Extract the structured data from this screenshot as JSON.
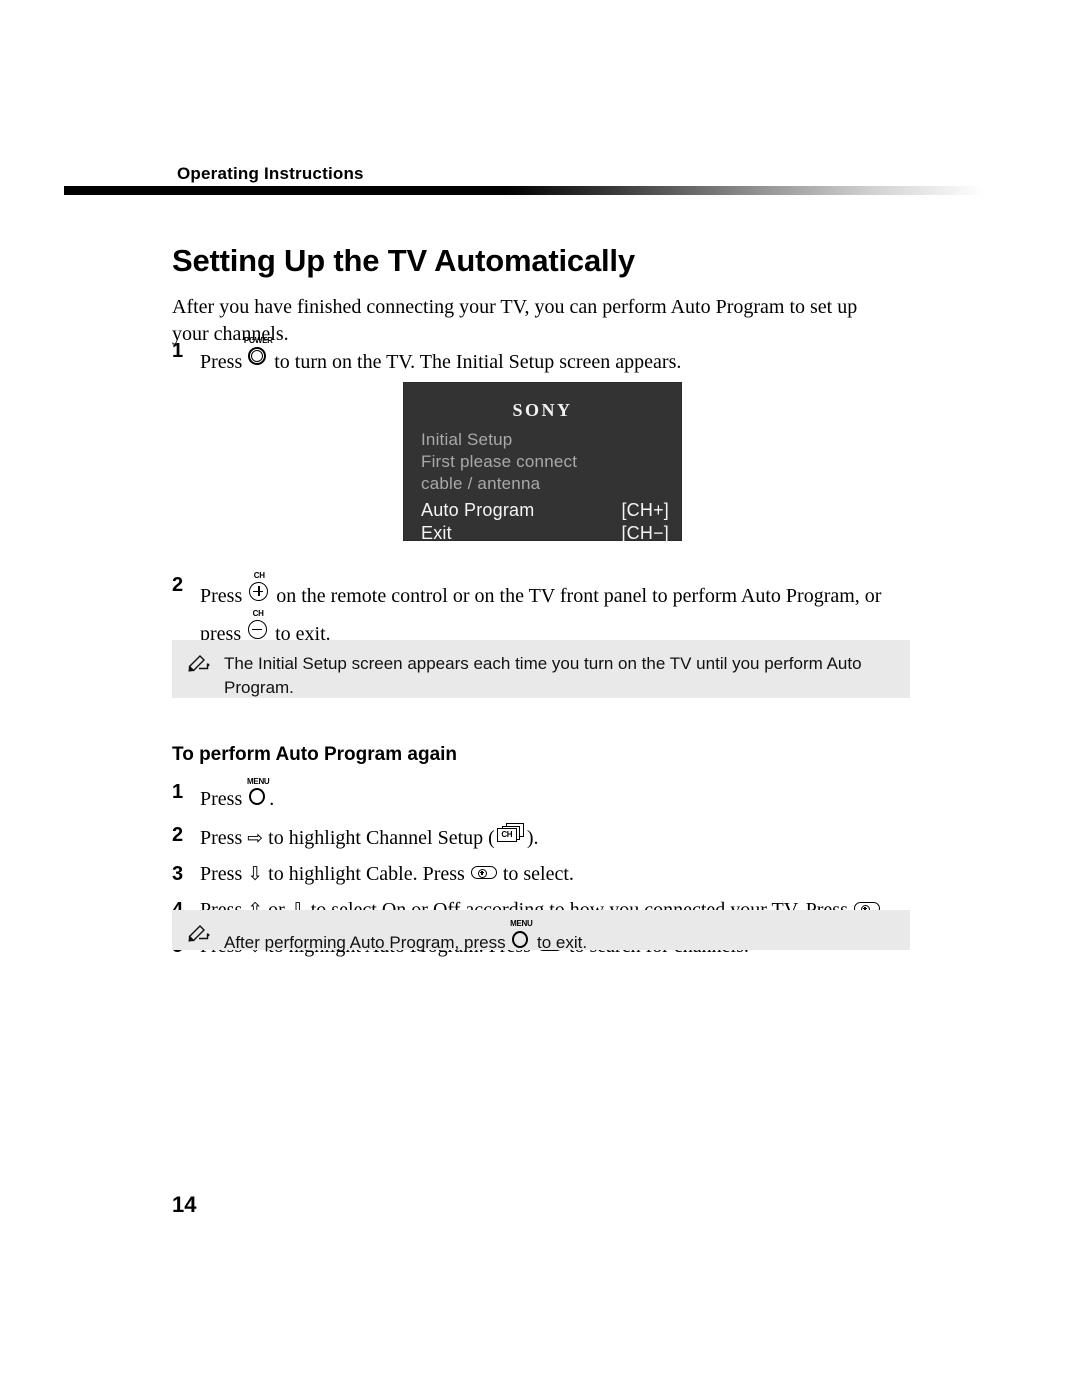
{
  "header": {
    "running_head": "Operating Instructions",
    "rule_color_start": "#000000",
    "rule_color_end": "#ffffff"
  },
  "page_title": "Setting Up the TV Automatically",
  "intro": "After you have finished connecting your TV, you can perform Auto Program to set up your channels.",
  "steps_main": [
    {
      "number": "1",
      "text_before": "Press",
      "icon": "power-button-icon",
      "icon_cap": "POWER",
      "text_after": "to turn on the TV. The Initial Setup screen appears."
    },
    {
      "number": "2",
      "text_before": "Press",
      "icon": "channel-up-button-icon",
      "icon_cap": "CH",
      "text_mid": "on the remote control or on the TV front panel to perform Auto Program, or press",
      "icon2": "channel-down-button-icon",
      "icon2_cap": "CH",
      "text_after": "to exit."
    }
  ],
  "tv_screen": {
    "brand": "SONY",
    "lines": [
      "Initial Setup",
      "First please connect",
      "cable / antenna"
    ],
    "menu": [
      {
        "label": "Auto Program",
        "key": "[CH+]"
      },
      {
        "label": "Exit",
        "key": "[CH−]"
      }
    ],
    "background_color": "#333333",
    "body_text_color": "#a9a9a9",
    "highlight_text_color": "#f5f5f5"
  },
  "note1": {
    "icon": "pencil-note-icon",
    "text": "The Initial Setup screen appears each time you turn on the TV until you perform Auto Program.",
    "background_color": "#e9e9e9"
  },
  "subsection_title": "To perform Auto Program again",
  "steps_sub": [
    {
      "number": "1",
      "text_before": "Press",
      "icon": "menu-button-icon",
      "icon_cap": "MENU",
      "text_after": "."
    },
    {
      "number": "2",
      "text_before": "Press",
      "arrow": "⇨",
      "text_mid": "to highlight Channel Setup (",
      "icon": "channel-setup-cards-icon",
      "icon_label": "CH",
      "text_after": ")."
    },
    {
      "number": "3",
      "text_before": "Press",
      "arrow": "⇩",
      "text_mid": "to highlight Cable. Press",
      "icon": "select-button-icon",
      "text_after": "to select."
    },
    {
      "number": "4",
      "text_before": "Press",
      "arrow": "⇧",
      "text_or": "or",
      "arrow2": "⇩",
      "text_mid": "to select On or Off according to how you connected your TV. Press",
      "icon": "select-button-icon",
      "text_after": "."
    },
    {
      "number": "5",
      "text_before": "Press",
      "arrow": "⇩",
      "text_mid": "to highlight Auto Program. Press",
      "icon": "select-button-icon",
      "text_after": "to search for channels."
    }
  ],
  "note2": {
    "icon": "pencil-note-icon",
    "text_before": "After performing Auto Program, press",
    "icon_key": "menu-button-icon",
    "icon_key_cap": "MENU",
    "text_after": "to exit.",
    "background_color": "#e9e9e9"
  },
  "folio": "14"
}
